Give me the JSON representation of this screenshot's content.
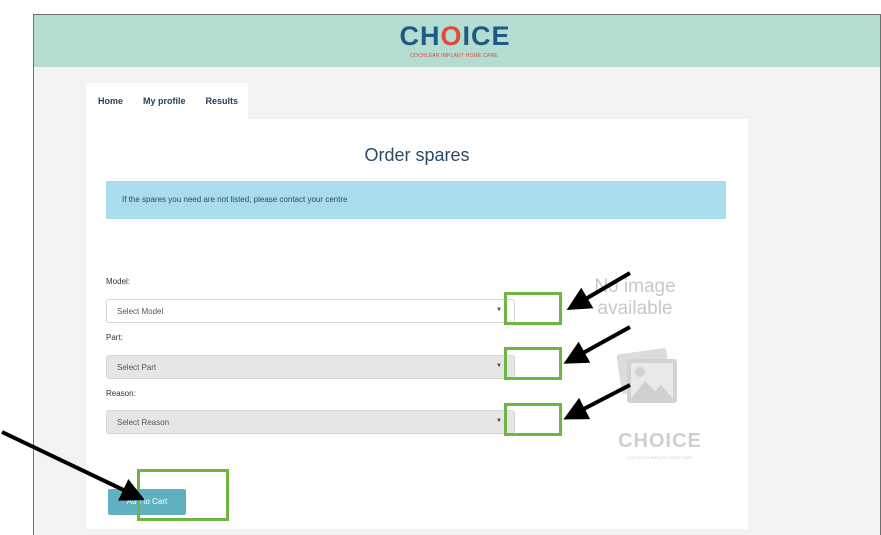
{
  "header": {
    "logo": "CHOICE",
    "logo_subtitle": "COCHLEAR IMPLANT HOME CARE"
  },
  "nav": {
    "items": [
      "Home",
      "My profile",
      "Results"
    ]
  },
  "page": {
    "title": "Order spares",
    "alert": "If the spares you need are not listed, please contact your centre"
  },
  "form": {
    "model": {
      "label": "Model:",
      "placeholder": "Select Model"
    },
    "part": {
      "label": "Part:",
      "placeholder": "Select Part"
    },
    "reason": {
      "label": "Reason:",
      "placeholder": "Select Reason"
    },
    "add_to_cart": "Add to Cart"
  },
  "no_image": {
    "line1": "No image",
    "line2": "available",
    "watermark_logo": "CHOICE",
    "watermark_subtitle": "COCHLEAR IMPLANT HOME CARE"
  },
  "colors": {
    "header_bg": "#b4dcd0",
    "alert_bg": "#a9dcec",
    "button_bg": "#5fb1c2",
    "highlight": "#6fb544",
    "accent_red": "#e04a36",
    "brand_blue": "#1f5a84"
  },
  "icons": {
    "caret": "chevron-down-icon",
    "arrow": "pointer-arrow-icon",
    "placeholder": "image-placeholder-icon"
  }
}
